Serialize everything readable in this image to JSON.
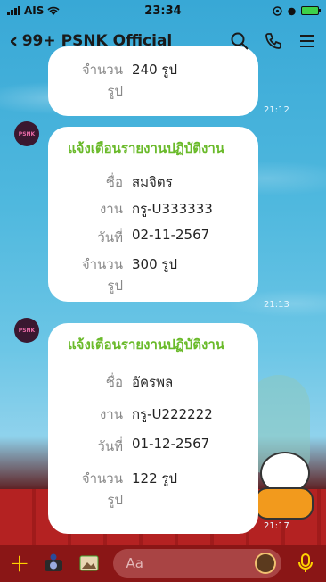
{
  "status_bar": {
    "carrier": "AIS",
    "time": "23:34"
  },
  "header": {
    "unread": "99+",
    "title": "PSNK Official"
  },
  "avatar_text": "PSNK",
  "messages": [
    {
      "partial": true,
      "rows": [
        {
          "label": "จำนวนรูป",
          "value": "240 รูป"
        }
      ],
      "time": "21:12"
    },
    {
      "title": "แจ้งเตือนรายงานปฏิบัติงาน",
      "rows": [
        {
          "label": "ชื่อ",
          "value": "สมจิตร"
        },
        {
          "label": "งาน",
          "value": "กรู-U333333"
        },
        {
          "label": "วันที่",
          "value": "02-11-2567"
        },
        {
          "label": "จำนวนรูป",
          "value": "300 รูป"
        }
      ],
      "time": "21:13"
    },
    {
      "title": "แจ้งเตือนรายงานปฏิบัติงาน",
      "rows": [
        {
          "label": "ชื่อ",
          "value": "อัครพล"
        },
        {
          "label": "งาน",
          "value": "กรู-U222222"
        },
        {
          "label": "วันที่",
          "value": "01-12-2567"
        },
        {
          "label": "จำนวนรูป",
          "value": "122 รูป"
        }
      ],
      "time": "21:17"
    }
  ],
  "input": {
    "placeholder": "Aa"
  },
  "icons": [
    "back-chevron-icon",
    "search-icon",
    "phone-icon",
    "menu-icon",
    "plus-icon",
    "camera-icon",
    "gallery-icon",
    "emoji-icon",
    "mic-icon"
  ],
  "colors": {
    "title_green": "#6aba2a",
    "bottom_bar": "#8a1616",
    "accent_yellow": "#ffd200"
  }
}
